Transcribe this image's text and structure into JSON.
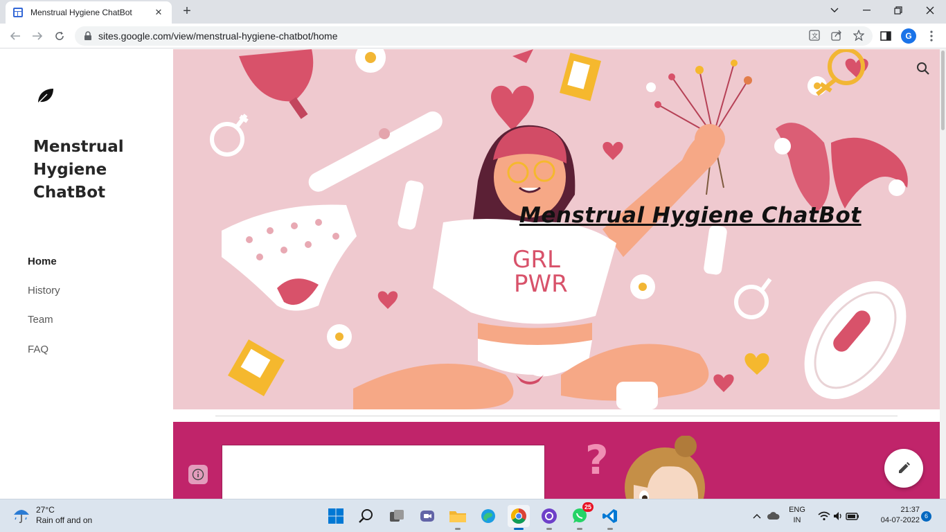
{
  "browser": {
    "tab_title": "Menstrual Hygiene ChatBot",
    "url": "sites.google.com/view/menstrual-hygiene-chatbot/home",
    "profile_initial": "G"
  },
  "site": {
    "title": "Menstrual Hygiene ChatBot",
    "nav": [
      {
        "label": "Home",
        "active": true
      },
      {
        "label": "History",
        "active": false
      },
      {
        "label": "Team",
        "active": false
      },
      {
        "label": "FAQ",
        "active": false
      }
    ],
    "hero_title": "Menstrual Hygiene ChatBot",
    "hero_shirt_text_line1": "GRL",
    "hero_shirt_text_line2": "PWR",
    "accent_color": "#c0246a",
    "hero_bg_color": "#efc9cf"
  },
  "taskbar": {
    "weather_temp": "27°C",
    "weather_desc": "Rain off and on",
    "whatsapp_badge": "25",
    "lang_line1": "ENG",
    "lang_line2": "IN",
    "time": "21:37",
    "date": "04-07-2022",
    "notification_count": "6"
  }
}
